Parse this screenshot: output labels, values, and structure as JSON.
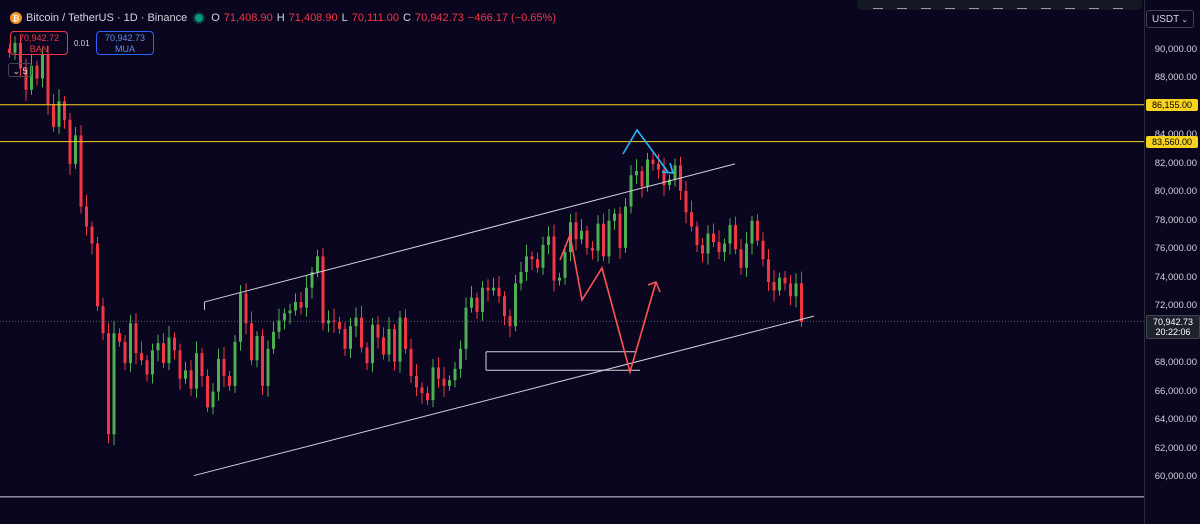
{
  "header": {
    "symbol": "Bitcoin / TetherUS · 1D · Binance",
    "open_label": "O",
    "open": "71,408.90",
    "high_label": "H",
    "high": "71,408.90",
    "low_label": "L",
    "low": "70,111.00",
    "close_label": "C",
    "close": "70,942.73",
    "change": "−466.17 (−0.65%)"
  },
  "trade": {
    "sell_price": "70,942.72",
    "sell_label": "BAN",
    "spread": "0.01",
    "buy_price": "70,942.73",
    "buy_label": "MUA"
  },
  "indicator_toggle": "5",
  "axis": {
    "currency": "USDT"
  },
  "price_tags": {
    "level_high": "86,155.00",
    "level_low": "83,560.00",
    "current_price": "70,942.73",
    "countdown": "20:22:06"
  },
  "colors": {
    "up": "#4caf50",
    "down": "#f23645",
    "level": "#f7d21e",
    "trendline": "#d1d4dc",
    "cyan": "#29b6f6",
    "red_arrow": "#ff5252",
    "background": "#0b0620"
  },
  "icons": [
    "bitcoin-icon",
    "market-open-dot-icon",
    "chevron-down-icon"
  ],
  "chart_data": {
    "type": "candlestick",
    "y_axis": {
      "ticks": [
        "60,000.00",
        "62,000.00",
        "64,000.00",
        "66,000.00",
        "68,000.00",
        "70,000.00",
        "72,000.00",
        "74,000.00",
        "76,000.00",
        "78,000.00",
        "80,000.00",
        "82,000.00",
        "84,000.00",
        "86,000.00",
        "88,000.00",
        "90,000.00"
      ],
      "range": [
        59000,
        93000
      ]
    },
    "grid": false,
    "horizontal_levels": [
      86155,
      83560,
      58600
    ],
    "current_price": 70942.73,
    "channel": {
      "upper": [
        [
          0.17,
          72300
        ],
        [
          0.61,
          82000
        ]
      ],
      "lower": [
        [
          0.16,
          60100
        ],
        [
          0.68,
          71300
        ]
      ]
    },
    "support_lines": [
      68800,
      67500
    ],
    "candle_closes": [
      89800,
      90500,
      88700,
      87200,
      88900,
      88000,
      89700,
      86200,
      84600,
      86400,
      85100,
      82000,
      84000,
      79000,
      77600,
      76400,
      72000,
      70100,
      63000,
      70100,
      69500,
      68000,
      70800,
      68700,
      68200,
      67200,
      68900,
      69400,
      68000,
      69800,
      68900,
      66900,
      67500,
      66200,
      68700,
      67100,
      64900,
      66000,
      68300,
      67100,
      66400,
      69500,
      72900,
      70800,
      68200,
      69900,
      66400,
      69000,
      70200,
      71000,
      71500,
      71700,
      72300,
      71900,
      73300,
      74400,
      75500,
      70800,
      71000,
      70900,
      70400,
      69000,
      70600,
      71200,
      69100,
      68000,
      70700,
      69800,
      68600,
      70400,
      68100,
      71200,
      69000,
      67100,
      66300,
      65900,
      65400,
      67700,
      66900,
      66400,
      66800,
      67600,
      69000,
      71900,
      72600,
      71600,
      73300,
      73100,
      73300,
      72700,
      71300,
      70600,
      73600,
      74400,
      75500,
      75300,
      74700,
      76300,
      76900,
      73800,
      74000,
      75800,
      77900,
      76700,
      77300,
      76100,
      75900,
      77800,
      75500,
      78000,
      78500,
      76100,
      79000,
      81200,
      81500,
      80400,
      82300,
      82000,
      81600,
      80500,
      80900,
      81900,
      80100,
      78600,
      77600,
      76300,
      75700,
      77100,
      76500,
      75800,
      76400,
      77700,
      76000,
      74700,
      76400,
      78000,
      76600,
      75300,
      73700,
      73100,
      74000,
      73600,
      72700,
      73600,
      70900
    ]
  }
}
